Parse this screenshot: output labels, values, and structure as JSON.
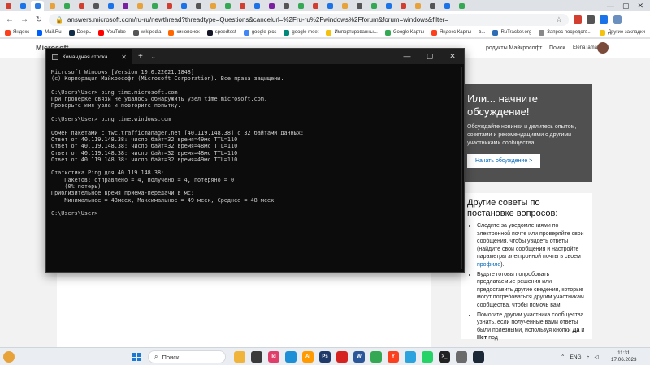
{
  "browser": {
    "url": "answers.microsoft.com/ru-ru/newthread?threadtype=Questions&cancelurl=%2Fru-ru%2Fwindows%2Fforum&forum=windows&filter=",
    "tab_colors": [
      "#d23f31",
      "#1a73e8",
      "#2a7ae2",
      "#e8a23a",
      "#34a853",
      "#d23f31",
      "#555555",
      "#1a73e8",
      "#7b1fa2",
      "#e8a23a",
      "#34a853",
      "#d23f31",
      "#1a73e8",
      "#555555",
      "#e8a23a",
      "#34a853",
      "#d23f31",
      "#1a73e8",
      "#7b1fa2",
      "#555555",
      "#34a853",
      "#d23f31",
      "#1a73e8",
      "#e8a23a",
      "#555555",
      "#34a853",
      "#1a73e8",
      "#d23f31",
      "#e8a23a",
      "#555555",
      "#1a73e8",
      "#34a853"
    ],
    "bookmarks": [
      {
        "label": "Яндекс",
        "color": "#fc3f1d"
      },
      {
        "label": "Mail.Ru",
        "color": "#005ff9"
      },
      {
        "label": "DeepL",
        "color": "#0f2b46"
      },
      {
        "label": "YouTube",
        "color": "#ff0000"
      },
      {
        "label": "wikipedia",
        "color": "#555555"
      },
      {
        "label": "кинопоиск",
        "color": "#ff6600"
      },
      {
        "label": "speedtest",
        "color": "#141526"
      },
      {
        "label": "google-pics",
        "color": "#4285f4"
      },
      {
        "label": "google meet",
        "color": "#00897b"
      },
      {
        "label": "Импортированны...",
        "color": "#f4c20d"
      },
      {
        "label": "Google Карты",
        "color": "#34a853"
      },
      {
        "label": "Яндекс Карты — в...",
        "color": "#fc3f1d"
      },
      {
        "label": "RuTracker.org",
        "color": "#2e6db4"
      },
      {
        "label": "Запрос посредств...",
        "color": "#888888"
      }
    ],
    "bookmarks_other": "Другие закладки"
  },
  "site": {
    "logo": "Microsoft",
    "nav_partial": "родукты Майкрософт",
    "search": "Поиск",
    "user": "ElenaTamarova"
  },
  "sidebar": {
    "promo_title": "Или... начните обсуждение!",
    "promo_text": "Обсуждайте новинки и делитесь опытом, советами и рекомендациями с другими участниками сообщества.",
    "promo_button": "Начать обсуждение >",
    "tips_title": "Другие советы по постановке вопросов:",
    "tips": [
      {
        "a": "Следите за уведомлениями по электронной почте или проверяйте свои сообщения, чтобы увидеть ответы (найдите свои сообщения и настройте параметры электронной почты в своем ",
        "link": "профиле",
        "b": ")."
      },
      {
        "a": "Будьте готовы попробовать предлагаемые решения или предоставить другие сведения, которые могут потребоваться другим участникам сообщества, чтобы помочь вам.",
        "link": "",
        "b": ""
      },
      {
        "a": "Помогите другим участника сообщества узнать, если полученные вами ответы были полезными, используя кнопки ",
        "bold1": "Да",
        "mid": " и ",
        "bold2": "Нет",
        "b": " под"
      }
    ]
  },
  "console": {
    "tab_title": "Командная строка",
    "lines": [
      "Microsoft Windows [Version 10.0.22621.1848]",
      "(c) Корпорация Майкрософт (Microsoft Corporation). Все права защищены.",
      "",
      "C:\\Users\\User> ping time.microsoft.com",
      "При проверке связи не удалось обнаружить узел time.microsoft.com.",
      "Проверьте имя узла и повторите попытку.",
      "",
      "C:\\Users\\User> ping time.windows.com",
      "",
      "Обмен пакетами с twc.trafficmanager.net [40.119.148.38] с 32 байтами данных:",
      "Ответ от 40.119.148.38: число байт=32 время=49мс TTL=110",
      "Ответ от 40.119.148.38: число байт=32 время=48мс TTL=110",
      "Ответ от 40.119.148.38: число байт=32 время=48мс TTL=110",
      "Ответ от 40.119.148.38: число байт=32 время=49мс TTL=110",
      "",
      "Статистика Ping для 40.119.148.38:",
      "    Пакетов: отправлено = 4, получено = 4, потеряно = 0",
      "    (0% потерь)",
      "Приблизительное время приема-передачи в мс:",
      "    Минимальное = 48мсек, Максимальное = 49 мсек, Среднее = 48 мсек",
      "",
      "C:\\Users\\User>"
    ]
  },
  "taskbar": {
    "search_label": "Поиск",
    "apps": [
      {
        "name": "file-explorer",
        "color": "#f0b43a",
        "glyph": ""
      },
      {
        "name": "camera",
        "color": "#3a3a3a",
        "glyph": ""
      },
      {
        "name": "indesign",
        "color": "#e03d6b",
        "glyph": "Id"
      },
      {
        "name": "edge",
        "color": "#1d8fd6",
        "glyph": ""
      },
      {
        "name": "illustrator",
        "color": "#ff9a00",
        "glyph": "Ai"
      },
      {
        "name": "photoshop",
        "color": "#1e3a68",
        "glyph": "Ps"
      },
      {
        "name": "acrobat",
        "color": "#d7231f",
        "glyph": ""
      },
      {
        "name": "word",
        "color": "#2b579a",
        "glyph": "W"
      },
      {
        "name": "chrome",
        "color": "#34a853",
        "glyph": ""
      },
      {
        "name": "yandex",
        "color": "#fc3f1d",
        "glyph": "Y"
      },
      {
        "name": "telegram",
        "color": "#2aa3de",
        "glyph": ""
      },
      {
        "name": "whatsapp",
        "color": "#25d366",
        "glyph": ""
      },
      {
        "name": "terminal",
        "color": "#222222",
        "glyph": ">_"
      },
      {
        "name": "settings",
        "color": "#6b6b6b",
        "glyph": ""
      },
      {
        "name": "steam",
        "color": "#1b2838",
        "glyph": ""
      }
    ],
    "lang": "ENG",
    "time": "11:31",
    "date": "17.06.2023"
  }
}
